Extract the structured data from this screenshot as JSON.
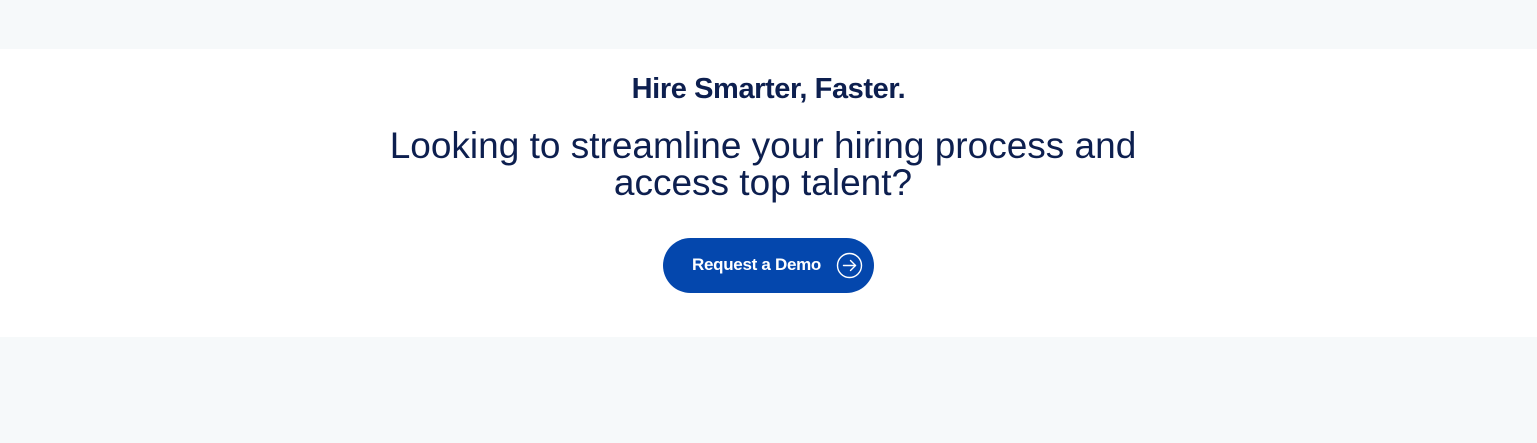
{
  "cta": {
    "heading": "Hire Smarter, Faster.",
    "subheading": "Looking to streamline your hiring process and access top talent?",
    "button_label": "Request a Demo",
    "button_icon": "arrow-right-circle-icon"
  },
  "colors": {
    "page_background": "#f6f9fa",
    "section_background": "#ffffff",
    "text": "#0d1f4f",
    "button": "#0447ad",
    "button_text": "#ffffff"
  }
}
